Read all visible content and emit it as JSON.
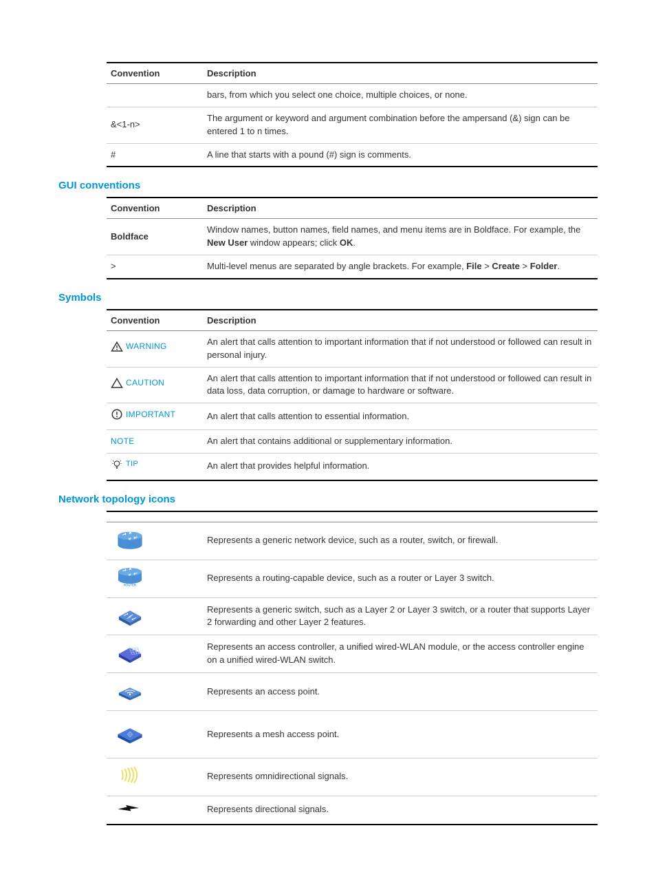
{
  "table1": {
    "headers": {
      "conv": "Convention",
      "desc": "Description"
    },
    "rows": [
      {
        "conv": "",
        "desc": "bars, from which you select one choice, multiple choices, or none."
      },
      {
        "conv": "&<1-n>",
        "desc": "The argument or keyword and argument combination before the ampersand (&) sign can be entered 1 to n times."
      },
      {
        "conv": "#",
        "desc": "A line that starts with a pound (#) sign is comments."
      }
    ]
  },
  "gui": {
    "heading": "GUI conventions",
    "headers": {
      "conv": "Convention",
      "desc": "Description"
    },
    "rows": {
      "r0": {
        "conv": "Boldface",
        "desc_pre": "Window names, button names, field names, and menu items are in Boldface. For example, the ",
        "b1": "New User",
        "mid": " window appears; click ",
        "b2": "OK",
        "post": "."
      },
      "r1": {
        "conv": ">",
        "desc_pre": "Multi-level menus are separated by angle brackets. For example, ",
        "b1": "File",
        "sep": " > ",
        "b2": "Create",
        "b3": "Folder",
        "post": "."
      }
    }
  },
  "symbols": {
    "heading": "Symbols",
    "headers": {
      "conv": "Convention",
      "desc": "Description"
    },
    "rows": [
      {
        "label": "WARNING",
        "desc": "An alert that calls attention to important information that if not understood or followed can result in personal injury."
      },
      {
        "label": "CAUTION",
        "desc": "An alert that calls attention to important information that if not understood or followed can result in data loss, data corruption, or damage to hardware or software."
      },
      {
        "label": "IMPORTANT",
        "desc": "An alert that calls attention to essential information."
      },
      {
        "label": "NOTE",
        "desc": "An alert that contains additional or supplementary information."
      },
      {
        "label": "TIP",
        "desc": "An alert that provides helpful information."
      }
    ]
  },
  "topology": {
    "heading": "Network topology icons",
    "rows": [
      {
        "desc": "Represents a generic network device, such as a router, switch, or firewall."
      },
      {
        "desc": "Represents a routing-capable device, such as a router or Layer 3 switch."
      },
      {
        "desc": "Represents a generic switch, such as a Layer 2 or Layer 3 switch, or a router that supports Layer 2 forwarding and other Layer 2 features."
      },
      {
        "desc": "Represents an access controller, a unified wired-WLAN module, or the access controller engine on a unified wired-WLAN switch."
      },
      {
        "desc": "Represents an access point."
      },
      {
        "desc": "Represents a mesh access point."
      },
      {
        "desc": "Represents omnidirectional signals."
      },
      {
        "desc": "Represents directional signals."
      }
    ]
  }
}
